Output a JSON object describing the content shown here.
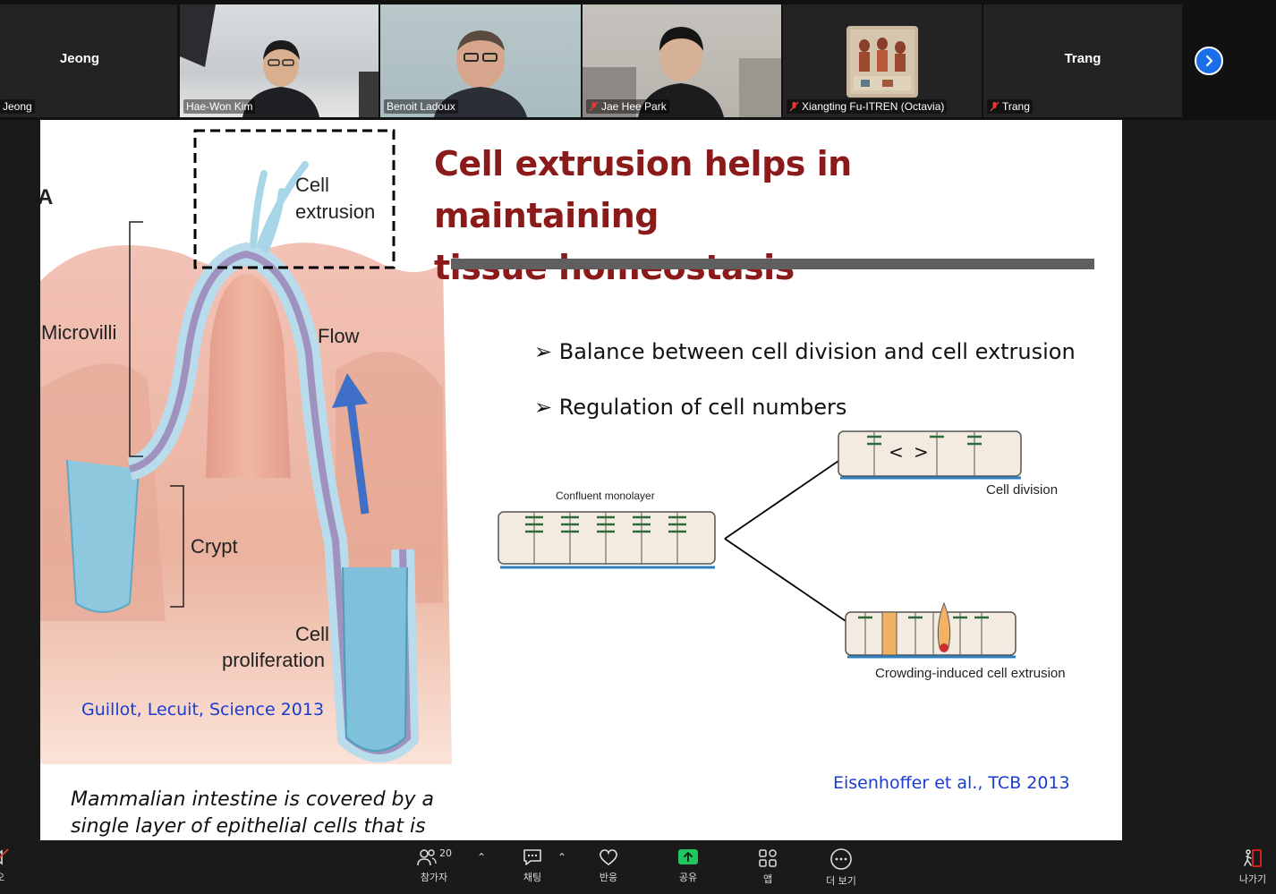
{
  "participants": [
    {
      "big_name": "Jeong",
      "name": "Jeong",
      "muted": false,
      "has_video": false
    },
    {
      "name": "Hae-Won Kim",
      "muted": false,
      "has_video": true
    },
    {
      "name": "Benoit Ladoux",
      "muted": false,
      "has_video": true,
      "active_speaker": true
    },
    {
      "name": "Jae Hee Park",
      "muted": true,
      "has_video": true
    },
    {
      "name": "Xiangting Fu-ITREN (Octavia)",
      "muted": true,
      "has_video": false
    },
    {
      "big_name": "Trang",
      "name": "Trang",
      "muted": true,
      "has_video": false
    }
  ],
  "slide": {
    "title_line1": "Cell extrusion helps in maintaining",
    "title_line2": "tissue homeostasis",
    "bullets": [
      "➢ Balance between cell division and cell extrusion",
      "➢ Regulation of cell numbers"
    ],
    "figure_labels": {
      "panel": "A",
      "cell": "Cell",
      "extrusion": "extrusion",
      "microvilli": "Microvilli",
      "flow": "Flow",
      "crypt": "Crypt",
      "cell2": "Cell",
      "proliferation": "proliferation",
      "confluent": "Confluent monolayer",
      "division": "Cell division",
      "crowding": "Crowding-induced cell extrusion"
    },
    "citation_left": "Guillot, Lecuit, Science 2013",
    "citation_right": "Eisenhoffer et al., TCB 2013",
    "caption_line1": "Mammalian intestine is covered by a",
    "caption_line2": "single layer of epithelial cells that is"
  },
  "toolbar": {
    "left_label": "오",
    "participants_label": "참가자",
    "participants_count": "20",
    "chat_label": "채팅",
    "reactions_label": "반응",
    "share_label": "공유",
    "apps_label": "앱",
    "more_label": "더 보기",
    "leave_label": "나가기"
  },
  "colors": {
    "active_border": "#2fd286",
    "share_green": "#22c55e",
    "leave_red": "#e02424",
    "title_red": "#8b1a1a",
    "cite_blue": "#1a3ccf"
  }
}
